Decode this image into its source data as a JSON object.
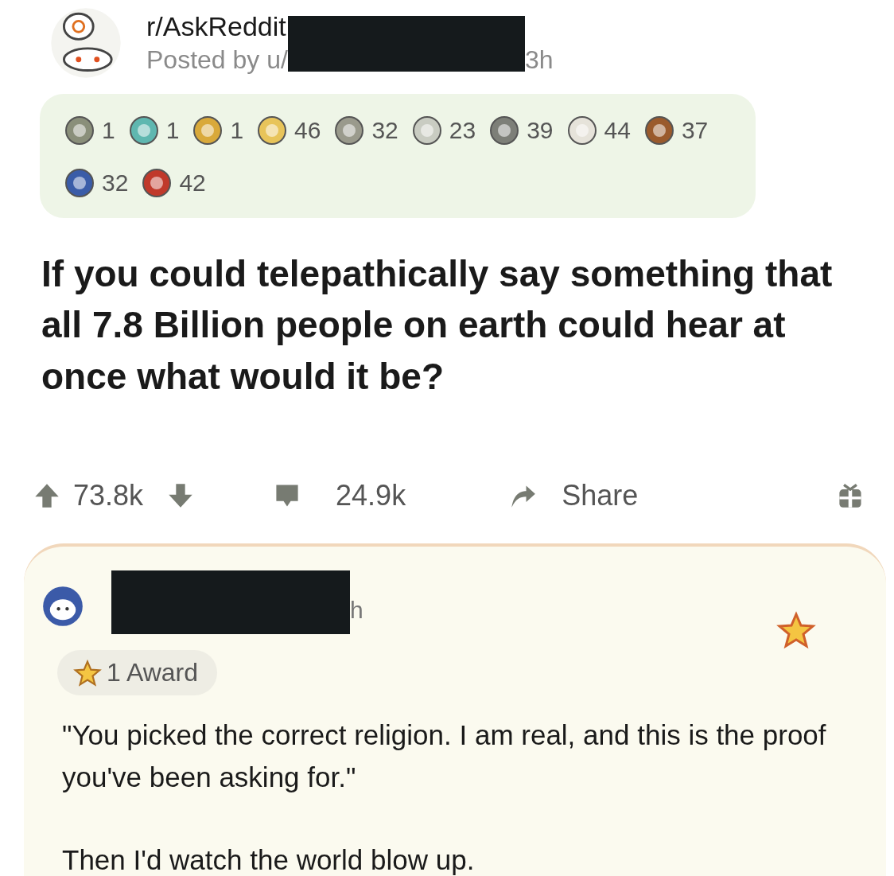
{
  "post": {
    "subreddit": "r/AskReddit",
    "posted_by": "Posted by u/",
    "age": "3h",
    "awards": [
      {
        "color": "#8a8f7a",
        "count": "1"
      },
      {
        "color": "#5fb7b0",
        "count": "1"
      },
      {
        "color": "#d9a93a",
        "count": "1"
      },
      {
        "color": "#e8c45a",
        "count": "46"
      },
      {
        "color": "#9a9a8c",
        "count": "32"
      },
      {
        "color": "#c9ccc2",
        "count": "23"
      },
      {
        "color": "#7d7f78",
        "count": "39"
      },
      {
        "color": "#e6e3da",
        "count": "44"
      },
      {
        "color": "#9a5a2c",
        "count": "37"
      },
      {
        "color": "#3a5ca8",
        "count": "32"
      },
      {
        "color": "#c0392b",
        "count": "42"
      }
    ],
    "title": "If you could telepathically say something that all 7.8 Billion people on earth could hear at once what would it be?",
    "upvotes": "73.8k",
    "comments": "24.9k",
    "share": "Share"
  },
  "comment": {
    "age": "h",
    "award_label": "1 Award",
    "paragraphs": [
      "\"You picked the correct religion. I am real, and this is the proof you've been asking for.\"",
      "Then I'd watch the world blow up."
    ]
  }
}
